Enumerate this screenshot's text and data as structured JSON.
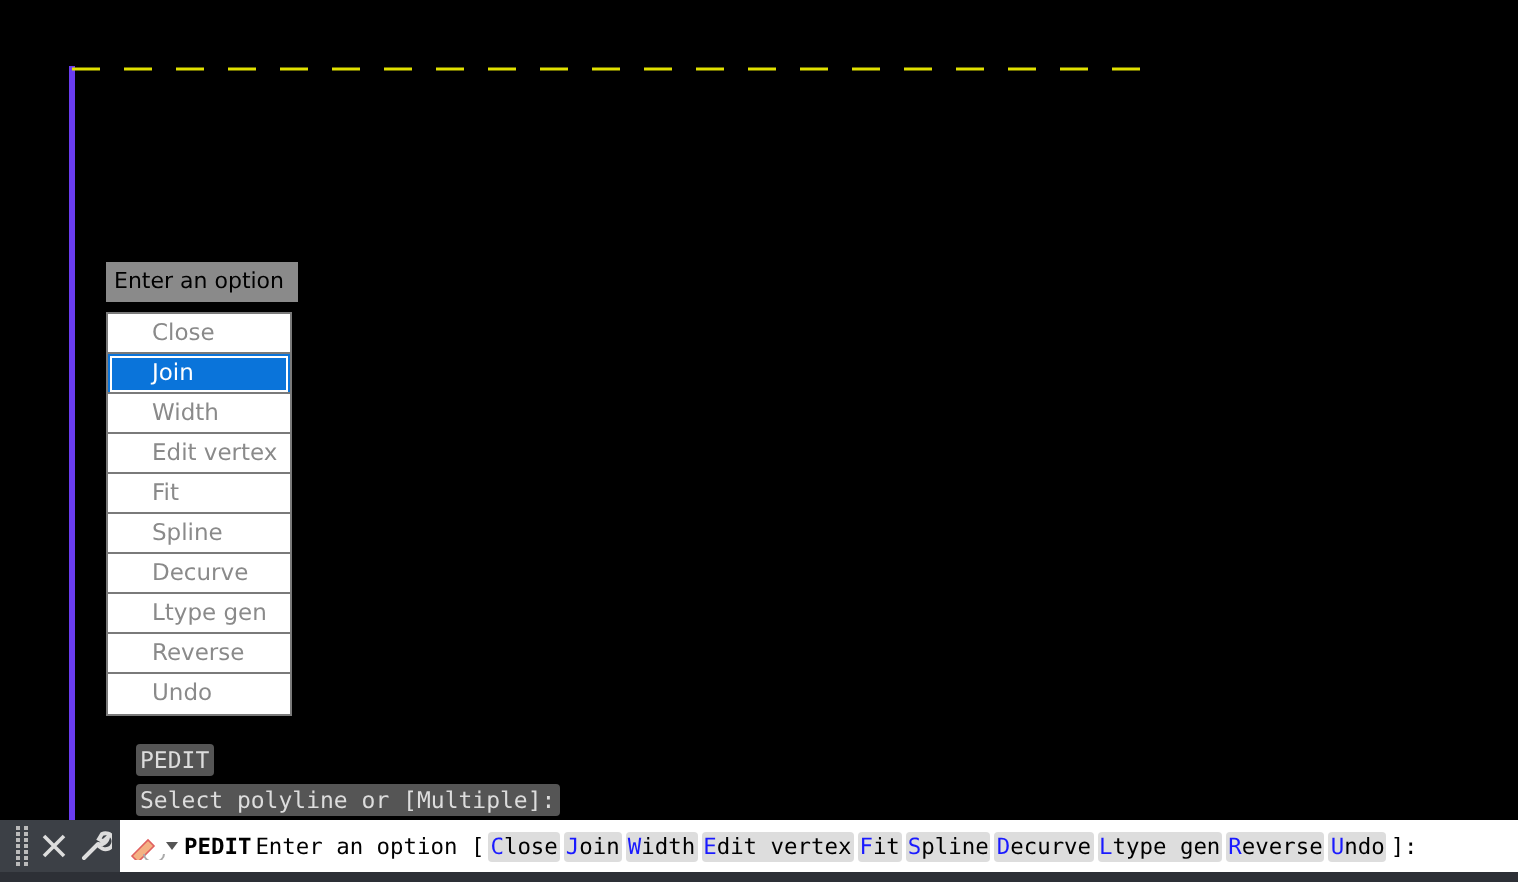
{
  "popup": {
    "title": "Enter an option",
    "options": [
      {
        "label": "Close",
        "selected": false
      },
      {
        "label": "Join",
        "selected": true
      },
      {
        "label": "Width",
        "selected": false
      },
      {
        "label": "Edit vertex",
        "selected": false
      },
      {
        "label": "Fit",
        "selected": false
      },
      {
        "label": "Spline",
        "selected": false
      },
      {
        "label": "Decurve",
        "selected": false
      },
      {
        "label": "Ltype gen",
        "selected": false
      },
      {
        "label": "Reverse",
        "selected": false
      },
      {
        "label": "Undo",
        "selected": false
      }
    ]
  },
  "history": [
    "PEDIT",
    "Select polyline or [Multiple]:"
  ],
  "command_line": {
    "command": "PEDIT",
    "prompt": "Enter an option [",
    "options": [
      "Close",
      "Join",
      "Width",
      "Edit vertex",
      "Fit",
      "Spline",
      "Decurve",
      "Ltype gen",
      "Reverse",
      "Undo"
    ],
    "suffix": "]:"
  }
}
